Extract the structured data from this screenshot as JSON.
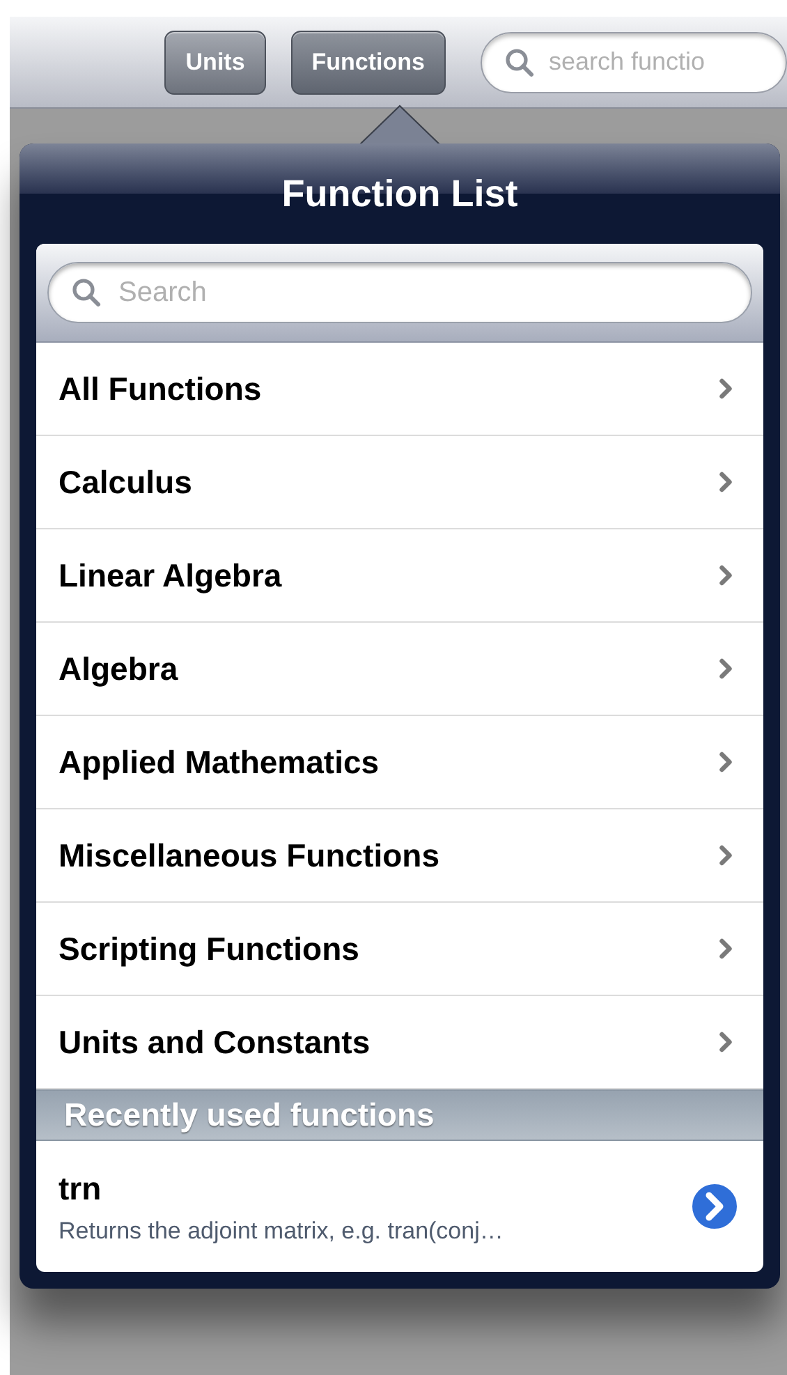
{
  "toolbar": {
    "buttons": [
      {
        "label": "Units",
        "selected": false
      },
      {
        "label": "Functions",
        "selected": true
      }
    ],
    "search": {
      "placeholder": "search functio"
    }
  },
  "popover": {
    "title": "Function List",
    "search": {
      "placeholder": "Search"
    },
    "categories": [
      {
        "label": "All Functions"
      },
      {
        "label": "Calculus"
      },
      {
        "label": "Linear Algebra"
      },
      {
        "label": "Algebra"
      },
      {
        "label": "Applied Mathematics"
      },
      {
        "label": "Miscellaneous Functions"
      },
      {
        "label": "Scripting Functions"
      },
      {
        "label": "Units and Constants"
      }
    ],
    "recent_header": "Recently used functions",
    "recent": [
      {
        "name": "trn",
        "description": "Returns the adjoint matrix, e.g. tran(conj…"
      }
    ]
  }
}
